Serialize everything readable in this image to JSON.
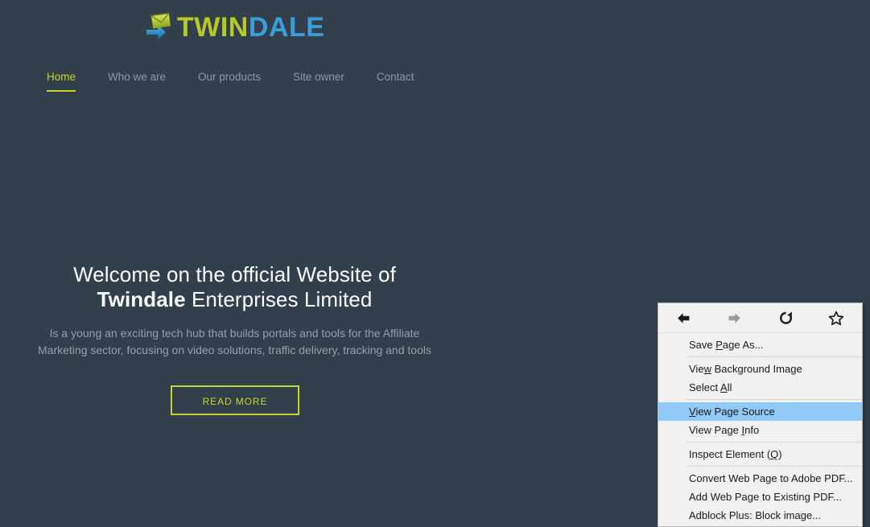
{
  "site": {
    "brand": {
      "part1": "TWIN",
      "part2": "DALE",
      "icon": "envelope-arrow-logo-icon",
      "color1": "#b5c92b",
      "color2": "#3a9fd8"
    },
    "nav": [
      {
        "label": "Home",
        "active": true
      },
      {
        "label": "Who we are",
        "active": false
      },
      {
        "label": "Our products",
        "active": false
      },
      {
        "label": "Site owner",
        "active": false
      },
      {
        "label": "Contact",
        "active": false
      }
    ],
    "hero": {
      "line1": "Welcome on the official Website of",
      "line2_strong": "Twindale",
      "line2_rest": " Enterprises Limited",
      "paragraph": "Is a young an exciting tech hub that builds portals and tools for the Affiliate Marketing sector, focusing on video solutions, traffic delivery, tracking and tools",
      "cta_label": "READ MORE"
    },
    "colors": {
      "background": "#333f4a",
      "accent": "#c5d42f",
      "muted_text": "#8e99a3"
    }
  },
  "context_menu": {
    "toolbar": [
      {
        "name": "back-icon",
        "label": "Back",
        "enabled": true
      },
      {
        "name": "forward-icon",
        "label": "Forward",
        "enabled": false
      },
      {
        "name": "reload-icon",
        "label": "Reload",
        "enabled": true
      },
      {
        "name": "bookmark-star-icon",
        "label": "Bookmark This Page",
        "enabled": true
      }
    ],
    "items": [
      {
        "type": "item",
        "pre": "Save ",
        "accel": "P",
        "post": "age As...",
        "selected": false
      },
      {
        "type": "separator"
      },
      {
        "type": "item",
        "pre": "Vie",
        "accel": "w",
        "post": " Background Image",
        "selected": false
      },
      {
        "type": "item",
        "pre": "Select ",
        "accel": "A",
        "post": "ll",
        "selected": false
      },
      {
        "type": "separator"
      },
      {
        "type": "item",
        "pre": "",
        "accel": "V",
        "post": "iew Page Source",
        "selected": true
      },
      {
        "type": "item",
        "pre": "View Page ",
        "accel": "I",
        "post": "nfo",
        "selected": false
      },
      {
        "type": "separator"
      },
      {
        "type": "item",
        "pre": "Inspect Element (",
        "accel": "Q",
        "post": ")",
        "selected": false
      },
      {
        "type": "separator"
      },
      {
        "type": "item",
        "pre": "Convert Web Page to Adobe PDF...",
        "accel": "",
        "post": "",
        "selected": false
      },
      {
        "type": "item",
        "pre": "Add Web Page to Existing PDF...",
        "accel": "",
        "post": "",
        "selected": false
      },
      {
        "type": "item",
        "pre": "Adblock Plus: Block image...",
        "accel": "",
        "post": "",
        "selected": false
      }
    ],
    "highlight_color": "#91c9f7",
    "background_color": "#f1f1f1"
  }
}
